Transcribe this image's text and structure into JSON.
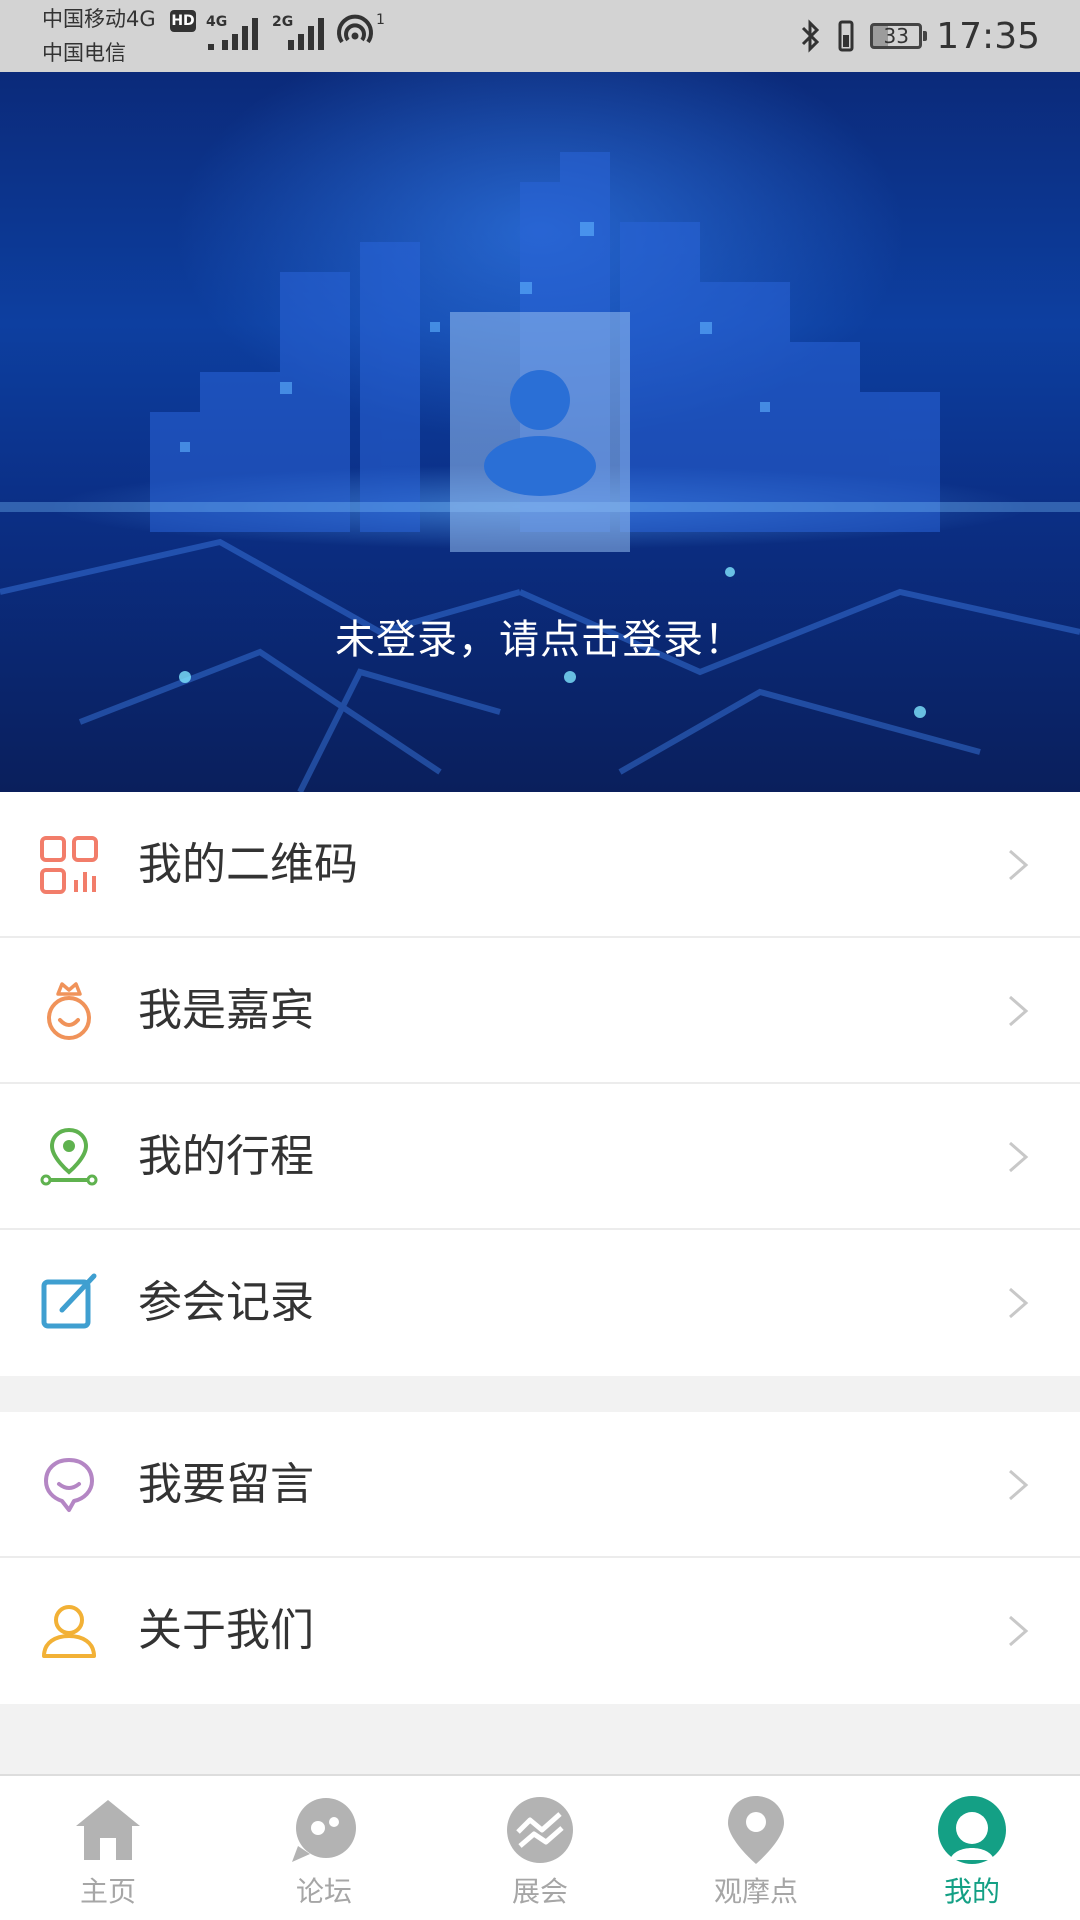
{
  "status_bar": {
    "carrier_primary": "中国移动4G",
    "carrier_secondary": "中国电信",
    "hd_badge": "HD",
    "signal1_tag": "4G",
    "signal2_tag": "2G",
    "hotspot_count": "1",
    "battery_level": "33",
    "time": "17:35"
  },
  "header": {
    "login_prompt": "未登录，请点击登录！"
  },
  "menu_group_1": [
    {
      "label": "我的二维码",
      "icon": "qr-code-icon",
      "color": "#f27d6a"
    },
    {
      "label": "我是嘉宾",
      "icon": "guest-crown-icon",
      "color": "#f0935a"
    },
    {
      "label": "我的行程",
      "icon": "route-pin-icon",
      "color": "#5fb24f"
    },
    {
      "label": "参会记录",
      "icon": "edit-record-icon",
      "color": "#3f9fd0"
    }
  ],
  "menu_group_2": [
    {
      "label": "我要留言",
      "icon": "message-bubble-icon",
      "color": "#b486c4"
    },
    {
      "label": "关于我们",
      "icon": "about-person-icon",
      "color": "#f2b136"
    }
  ],
  "tabbar": {
    "tabs": [
      {
        "label": "主页",
        "icon": "home-icon",
        "active": false
      },
      {
        "label": "论坛",
        "icon": "forum-icon",
        "active": false
      },
      {
        "label": "展会",
        "icon": "exhibition-icon",
        "active": false
      },
      {
        "label": "观摩点",
        "icon": "location-pin-icon",
        "active": false
      },
      {
        "label": "我的",
        "icon": "profile-icon",
        "active": true
      }
    ],
    "active_color": "#14a085",
    "inactive_color": "#a6a6a6"
  }
}
